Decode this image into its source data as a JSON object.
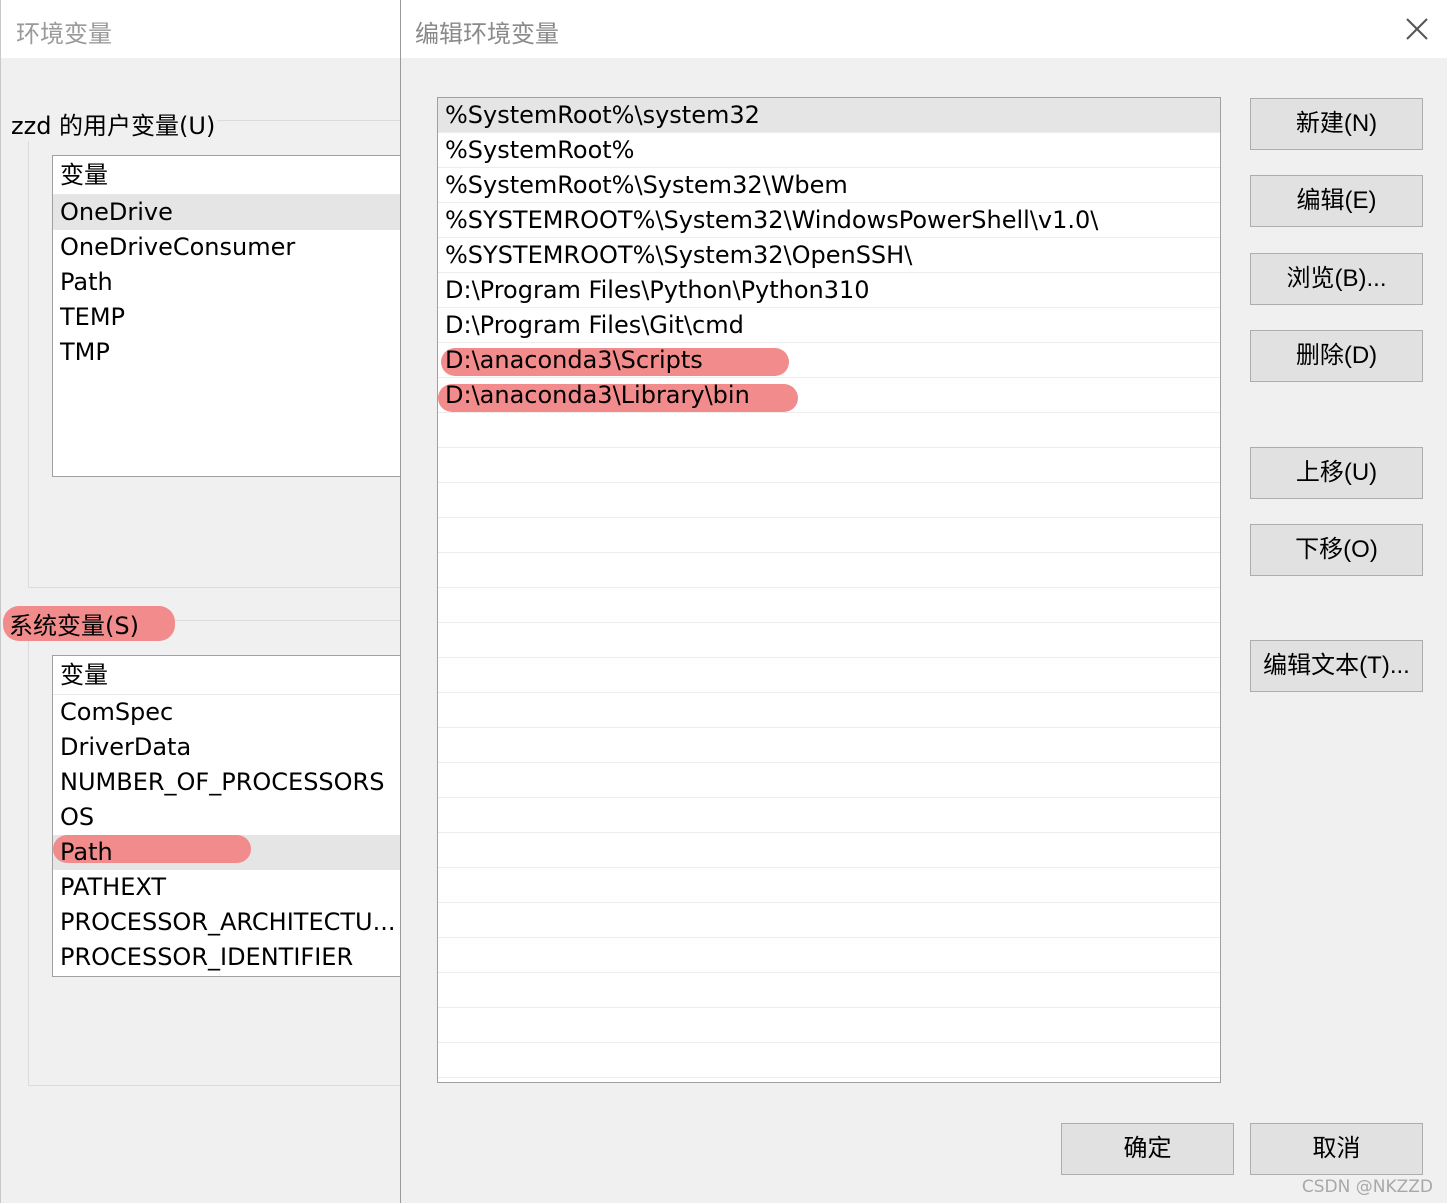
{
  "background_window": {
    "title": "环境变量",
    "user_group_label": "zzd 的用户变量(U)",
    "user_vars": {
      "header": "变量",
      "items": [
        "OneDrive",
        "OneDriveConsumer",
        "Path",
        "TEMP",
        "TMP"
      ]
    },
    "system_group_label": "系统变量(S)",
    "system_vars": {
      "header": "变量",
      "items": [
        "ComSpec",
        "DriverData",
        "NUMBER_OF_PROCESSORS",
        "OS",
        "Path",
        "PATHEXT",
        "PROCESSOR_ARCHITECTU...",
        "PROCESSOR_IDENTIFIER"
      ]
    }
  },
  "dialog": {
    "title": "编辑环境变量",
    "close_icon": "close-icon",
    "path_entries": [
      "%SystemRoot%\\system32",
      "%SystemRoot%",
      "%SystemRoot%\\System32\\Wbem",
      "%SYSTEMROOT%\\System32\\WindowsPowerShell\\v1.0\\",
      "%SYSTEMROOT%\\System32\\OpenSSH\\",
      "D:\\Program Files\\Python\\Python310",
      "D:\\Program Files\\Git\\cmd",
      "D:\\anaconda3\\Scripts",
      "D:\\anaconda3\\Library\\bin"
    ],
    "buttons": {
      "new": "新建(N)",
      "edit": "编辑(E)",
      "browse": "浏览(B)...",
      "delete": "删除(D)",
      "move_up": "上移(U)",
      "move_down": "下移(O)",
      "edit_text": "编辑文本(T)...",
      "ok": "确定",
      "cancel": "取消"
    }
  },
  "watermark": "CSDN @NKZZD",
  "colors": {
    "highlight": "#f28b8b",
    "selection": "#e5e5e5"
  }
}
